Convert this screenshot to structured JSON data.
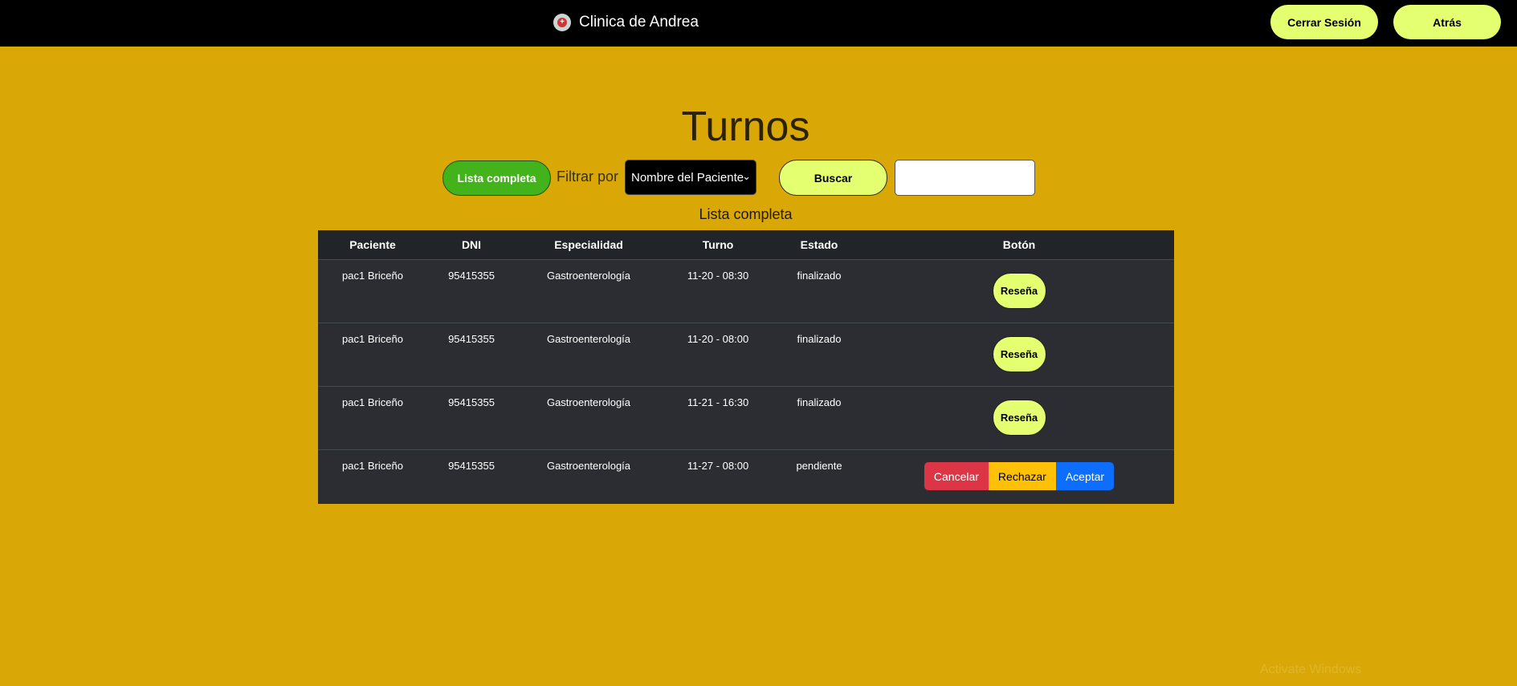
{
  "colors": {
    "background": "#d9a806",
    "topbar": "#000000",
    "accent_button": "#e4ff70",
    "primary_green": "#43b31c",
    "table_bg": "#2b2d33",
    "danger": "#dc3545",
    "warning": "#ffc107",
    "primary_blue": "#0d6efd"
  },
  "header": {
    "logo_icon": "clinic-logo-icon",
    "brand": "Clinica de Andrea",
    "logout_label": "Cerrar Sesión",
    "back_label": "Atrás"
  },
  "main": {
    "title": "Turnos",
    "full_list_button": "Lista completa",
    "filter_label": "Filtrar por",
    "filter_selected": "Nombre del Paciente",
    "search_button": "Buscar",
    "search_value": "",
    "list_caption": "Lista completa"
  },
  "table": {
    "columns": [
      "Paciente",
      "DNI",
      "Especialidad",
      "Turno",
      "Estado",
      "Botón"
    ],
    "rows": [
      {
        "paciente": "pac1 Briceño",
        "dni": "95415355",
        "especialidad": "Gastroenterología",
        "turno": "11-20 - 08:30",
        "estado": "finalizado",
        "action": "Reseña"
      },
      {
        "paciente": "pac1 Briceño",
        "dni": "95415355",
        "especialidad": "Gastroenterología",
        "turno": "11-20 - 08:00",
        "estado": "finalizado",
        "action": "Reseña"
      },
      {
        "paciente": "pac1 Briceño",
        "dni": "95415355",
        "especialidad": "Gastroenterología",
        "turno": "11-21 - 16:30",
        "estado": "finalizado",
        "action": "Reseña"
      },
      {
        "paciente": "pac1 Briceño",
        "dni": "95415355",
        "especialidad": "Gastroenterología",
        "turno": "11-27 - 08:00",
        "estado": "pendiente",
        "actions": [
          "Cancelar",
          "Rechazar",
          "Aceptar"
        ]
      }
    ]
  },
  "watermark": "Activate Windows"
}
